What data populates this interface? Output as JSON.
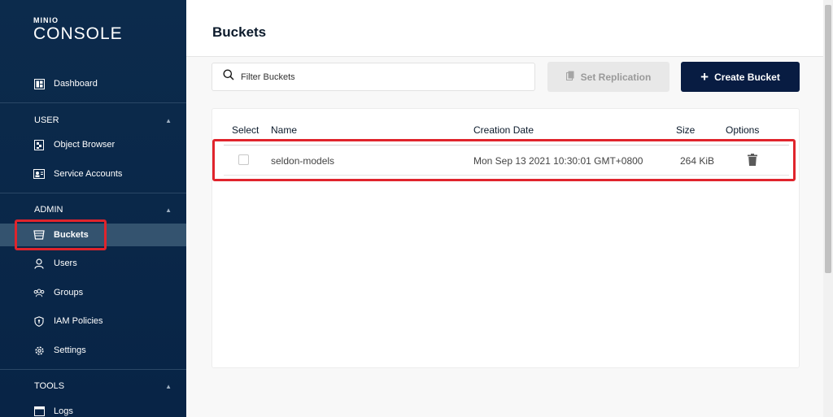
{
  "logo": {
    "small": "MINIO",
    "big": "CONSOLE"
  },
  "sidebar": {
    "dashboard": "Dashboard",
    "user_section": "USER",
    "object_browser": "Object Browser",
    "service_accounts": "Service Accounts",
    "admin_section": "ADMIN",
    "buckets": "Buckets",
    "users": "Users",
    "groups": "Groups",
    "iam_policies": "IAM Policies",
    "settings": "Settings",
    "tools_section": "TOOLS",
    "logs": "Logs"
  },
  "header": {
    "title": "Buckets"
  },
  "search": {
    "placeholder": "Filter Buckets"
  },
  "toolbar": {
    "set_replication": "Set Replication",
    "create_bucket": "Create Bucket"
  },
  "table": {
    "columns": {
      "select": "Select",
      "name": "Name",
      "creation_date": "Creation Date",
      "size": "Size",
      "options": "Options"
    },
    "rows": [
      {
        "name": "seldon-models",
        "creation_date": "Mon Sep 13 2021 10:30:01 GMT+0800",
        "size": "264 KiB"
      }
    ]
  },
  "colors": {
    "sidebar_bg": "#0c2b4c",
    "active_item": "#34536f",
    "primary_button": "#081c42",
    "highlight": "#e0242c"
  }
}
